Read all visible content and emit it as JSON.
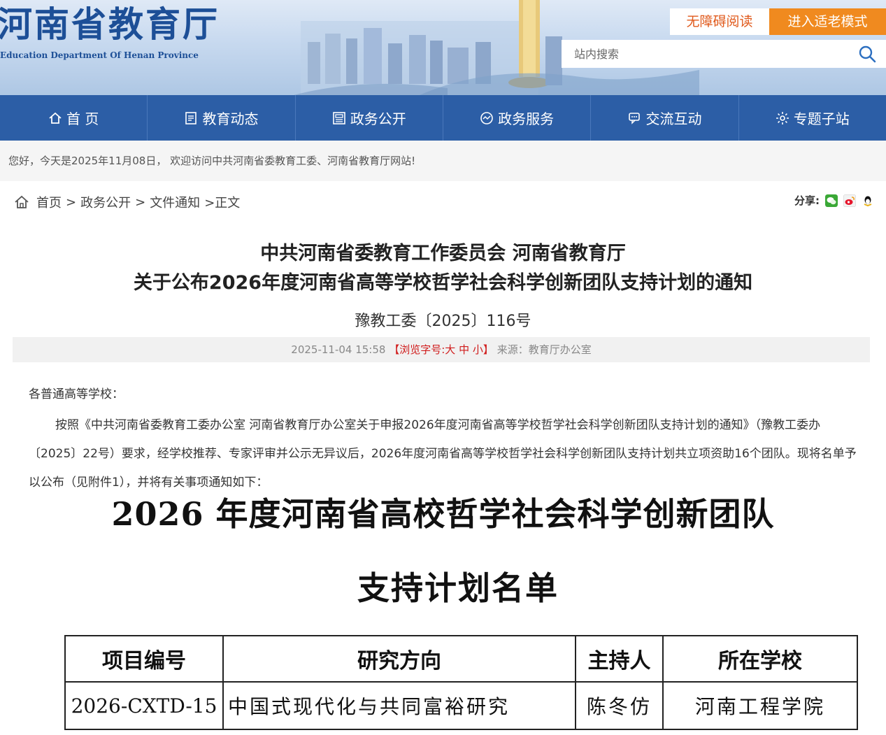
{
  "header": {
    "site_title": "河南省教育厅",
    "site_subtitle": "Education Department Of Henan Province",
    "accessible_label": "无障碍阅读",
    "elder_mode_label": "进入适老模式",
    "search_placeholder": "站内搜索"
  },
  "nav": {
    "items": [
      {
        "label": "首 页",
        "icon": "home-icon"
      },
      {
        "label": "教育动态",
        "icon": "news-icon"
      },
      {
        "label": "政务公开",
        "icon": "document-icon"
      },
      {
        "label": "政务服务",
        "icon": "service-icon"
      },
      {
        "label": "交流互动",
        "icon": "chat-icon"
      },
      {
        "label": "专题子站",
        "icon": "gear-icon"
      }
    ]
  },
  "welcome_text": "您好，今天是2025年11月08日， 欢迎访问中共河南省委教育工委、河南省教育厅网站!",
  "breadcrumb": {
    "home": "首页",
    "sep1": ">",
    "section": "政务公开",
    "sep2": ">",
    "sub": "文件通知",
    "current": ">正文"
  },
  "share": {
    "label": "分享:",
    "icons": [
      "wechat-icon",
      "weibo-icon",
      "qq-icon"
    ]
  },
  "article": {
    "title_line1": "中共河南省委教育工作委员会 河南省教育厅",
    "title_line2": "关于公布2026年度河南省高等学校哲学社会科学创新团队支持计划的通知",
    "doc_number": "豫教工委〔2025〕116号",
    "meta": {
      "datetime": "2025-11-04 15:58",
      "font_prefix": "【浏览字号:",
      "font_large": "大",
      "font_medium": "中",
      "font_small": "小",
      "font_suffix": "】",
      "source": "来源：教育厅办公室"
    },
    "salutation": "各普通高等学校：",
    "paragraph": "按照《中共河南省委教育工委办公室 河南省教育厅办公室关于申报2026年度河南省高等学校哲学社会科学创新团队支持计划的通知》（豫教工委办〔2025〕22号）要求，经学校推荐、专家评审并公示无异议后，2026年度河南省高等学校哲学社会科学创新团队支持计划共立项资助16个团队。现将名单予以公布（见附件1），并将有关事项通知如下："
  },
  "embedded": {
    "title_line1": "2026 年度河南省高校哲学社会科学创新团队",
    "title_line2": "支持计划名单",
    "table": {
      "headers": [
        "项目编号",
        "研究方向",
        "主持人",
        "所在学校"
      ],
      "rows": [
        [
          "2026-CXTD-15",
          "中国式现代化与共同富裕研究",
          "陈冬仿",
          "河南工程学院"
        ]
      ]
    }
  },
  "colors": {
    "nav_bg": "#2c5ea6",
    "title_blue": "#1d4f97",
    "elder_orange": "#f08a1f",
    "accent_red": "#d01c1c"
  }
}
